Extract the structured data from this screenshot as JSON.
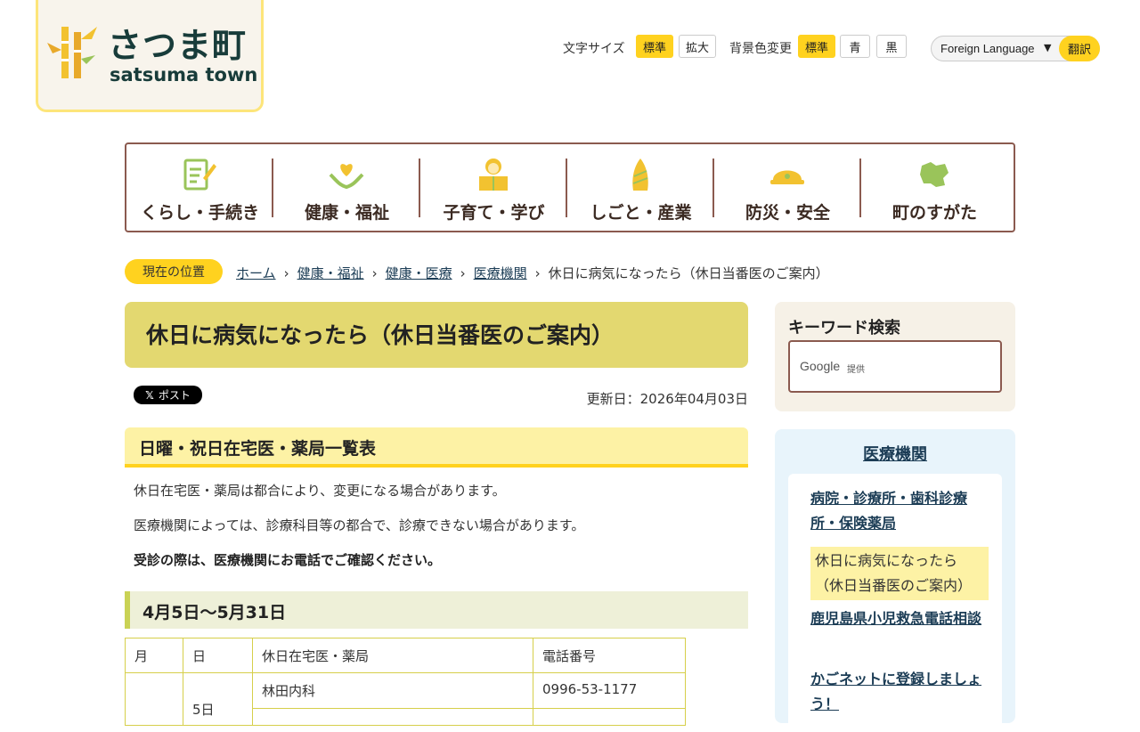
{
  "logo": {
    "jp": "さつま町",
    "en": "satsuma town"
  },
  "utility": {
    "font_size_label": "文字サイズ",
    "font_size_options": [
      "標準",
      "拡大"
    ],
    "bg_color_label": "背景色変更",
    "bg_color_options": [
      "標準",
      "青",
      "黒"
    ],
    "language_select": "Foreign Language",
    "translate_button": "翻訳"
  },
  "global_nav": [
    {
      "label": "くらし・手続き",
      "icon": "document-pen-icon"
    },
    {
      "label": "健康・福祉",
      "icon": "heart-hands-icon"
    },
    {
      "label": "子育て・学び",
      "icon": "child-book-icon"
    },
    {
      "label": "しごと・産業",
      "icon": "bamboo-shoot-icon"
    },
    {
      "label": "防災・安全",
      "icon": "helmet-icon"
    },
    {
      "label": "町のすがた",
      "icon": "map-icon"
    }
  ],
  "breadcrumb": {
    "badge": "現在の位置",
    "items": [
      "ホーム",
      "健康・福祉",
      "健康・医療",
      "医療機関"
    ],
    "current": "休日に病気になったら（休日当番医のご案内）"
  },
  "page": {
    "title": "休日に病気になったら（休日当番医のご案内）",
    "post_button": "ポスト",
    "updated": "更新日：2026年04月03日",
    "section_heading": "日曜・祝日在宅医・薬局一覧表",
    "notes": [
      "休日在宅医・薬局は都合により、変更になる場合があります。",
      "医療機関によっては、診療科目等の都合で、診療できない場合があります。",
      "受診の際は、医療機関にお電話でご確認ください。"
    ],
    "period_heading": "4月5日～5月31日"
  },
  "table": {
    "headers": [
      "月",
      "日",
      "休日在宅医・薬局",
      "電話番号"
    ],
    "rows": [
      {
        "month": "",
        "day": "5日",
        "facility": "林田内科",
        "phone": "0996-53-1177"
      }
    ]
  },
  "sidebar": {
    "search_title": "キーワード検索",
    "search_provider": "Google",
    "search_provider_sub": "提供",
    "related_title": "医療機関",
    "related_items": [
      "病院・診療所・歯科診療所・保険薬局",
      "休日に病気になったら（休日当番医のご案内）",
      "鹿児島県小児救急電話相談",
      "かごネットに登録しましょう！"
    ]
  },
  "colors": {
    "accent_yellow": "#ffd21f",
    "title_bg": "#e3d870",
    "nav_border": "#8b5a4f",
    "link": "#1b3c55"
  }
}
